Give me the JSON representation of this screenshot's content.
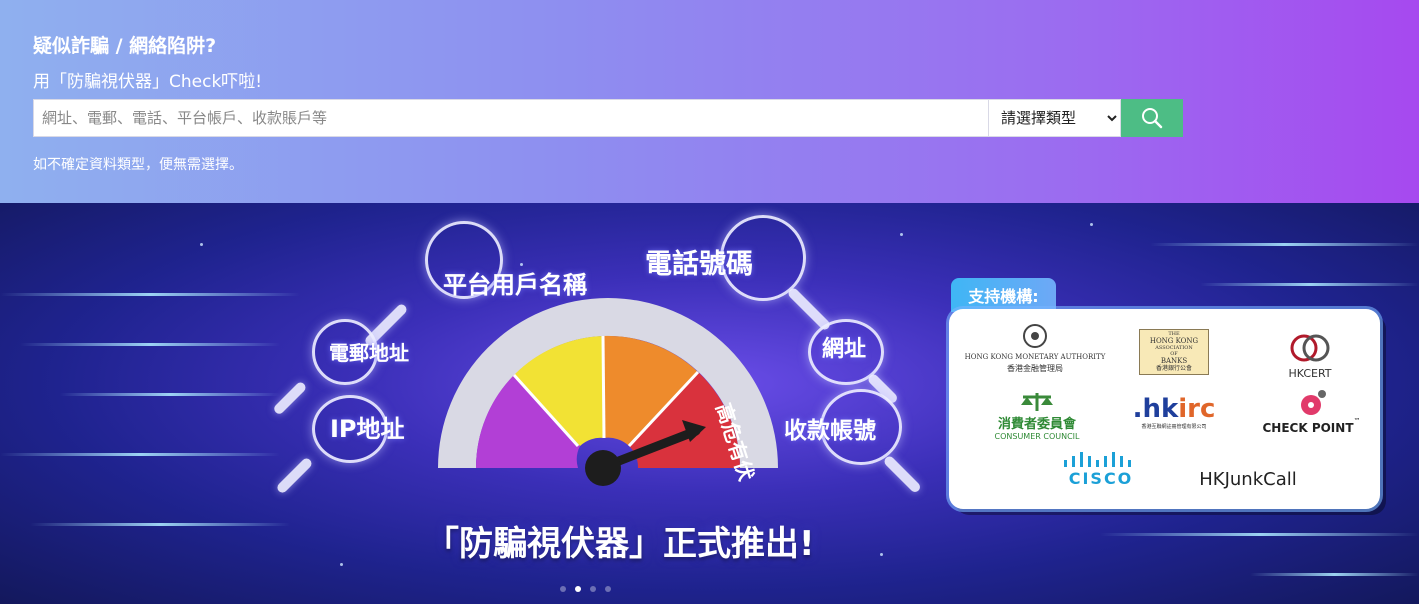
{
  "header": {
    "question": "疑似詐騙 / 網絡陷阱?",
    "subtitle": "用「防騙視伏器」Check吓啦!",
    "hint": "如不確定資料類型，便無需選擇。"
  },
  "search": {
    "placeholder": "網址、電郵、電話、平台帳戶、收款賬戶等",
    "value": "",
    "type_selected": "請選擇類型",
    "button_icon": "search-icon"
  },
  "banner": {
    "bubbles": {
      "platform_user": "平台用戶名稱",
      "phone": "電話號碼",
      "email": "電郵地址",
      "url": "網址",
      "ip": "IP地址",
      "account": "收款帳號"
    },
    "gauge_label": "高危有伏",
    "title": "「防騙視伏器」正式推出!",
    "support_tag": "支持機構:",
    "logos": {
      "hkma_en": "HONG KONG MONETARY AUTHORITY",
      "hkma_zh": "香港金融管理局",
      "hkab_1": "THE",
      "hkab_2": "HONG KONG",
      "hkab_3": "ASSOCIATION",
      "hkab_4": "OF",
      "hkab_5": "BANKS",
      "hkab_zh": "香港銀行公會",
      "hkcert": "HKCERT",
      "consumer_zh": "消費者委員會",
      "consumer_en": "CONSUMER COUNCIL",
      "hkirc_a": ".hk",
      "hkirc_b": "irc",
      "hkirc_sub": "香港互聯網註冊管理有限公司",
      "checkpoint": "CHECK POINT",
      "checkpoint_tm": "™",
      "cisco": "CISCO",
      "hkjunkcall": "HKJunkCall"
    },
    "slides_total": 4,
    "active_slide": 2
  },
  "colors": {
    "accent_green": "#4dbd85",
    "gauge_purple": "#b23fd6",
    "gauge_yellow": "#f2e234",
    "gauge_orange": "#ee8b2c",
    "gauge_red": "#d9323d"
  }
}
